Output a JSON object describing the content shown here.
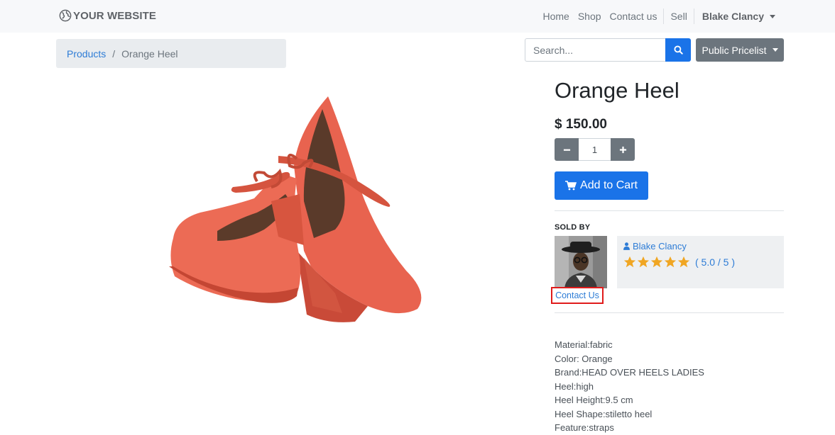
{
  "navbar": {
    "logo_text": "YOUR WEBSITE",
    "links": [
      "Home",
      "Shop",
      "Contact us",
      "Sell"
    ],
    "user": "Blake Clancy"
  },
  "breadcrumb": {
    "parent": "Products",
    "separator": "/",
    "current": "Orange Heel"
  },
  "search": {
    "placeholder": "Search..."
  },
  "pricelist": {
    "label": "Public Pricelist"
  },
  "product": {
    "name": "Orange Heel",
    "price": "$ 150.00",
    "quantity": "1",
    "add_to_cart": "Add to Cart",
    "image_color": "#e8634f"
  },
  "seller": {
    "heading": "SOLD BY",
    "name": "Blake Clancy",
    "rating": "( 5.0 / 5 )",
    "stars": 5,
    "contact_label": "Contact Us"
  },
  "description": [
    "Material:fabric",
    "Color: Orange",
    "Brand:HEAD OVER HEELS LADIES",
    "Heel:high",
    "Heel Height:9.5 cm",
    "Heel Shape:stiletto heel",
    "Feature:straps"
  ],
  "colors": {
    "primary": "#1a73e8",
    "secondary": "#6c757d",
    "link": "#2d7cd6",
    "star": "#f0a623",
    "highlight": "#e01b1b"
  }
}
